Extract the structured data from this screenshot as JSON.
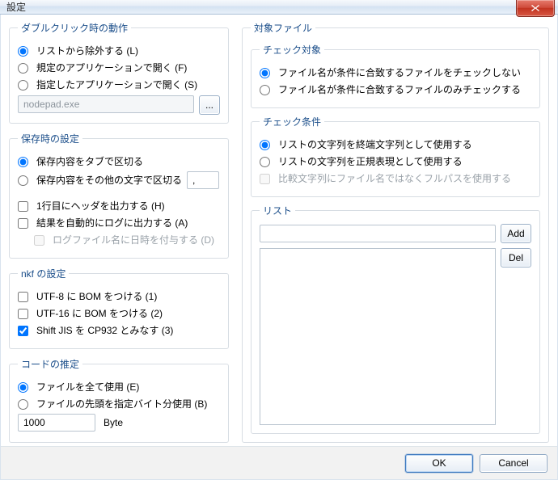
{
  "title": "設定",
  "close_icon": "close-icon",
  "dblclick": {
    "legend": "ダブルクリック時の動作",
    "opt_remove": "リストから除外する (L)",
    "opt_default_app": "規定のアプリケーションで開く (F)",
    "opt_specified_app": "指定したアプリケーションで開く (S)",
    "app_path": "nodepad.exe",
    "browse": "..."
  },
  "save": {
    "legend": "保存時の設定",
    "opt_tab": "保存内容をタブで区切る",
    "opt_other": "保存内容をその他の文字で区切る",
    "other_char": ",",
    "chk_header": "1行目にヘッダを出力する (H)",
    "chk_autolog": "結果を自動的にログに出力する (A)",
    "chk_logdate": "ログファイル名に日時を付与する (D)"
  },
  "nkf": {
    "legend": "nkf の設定",
    "chk_utf8": "UTF-8 に BOM をつける (1)",
    "chk_utf16": "UTF-16 に BOM をつける (2)",
    "chk_cp932": "Shift JIS を CP932 とみなす (3)"
  },
  "code": {
    "legend": "コードの推定",
    "opt_all": "ファイルを全て使用 (E)",
    "opt_head": "ファイルの先頭を指定バイト分使用 (B)",
    "bytes": "1000",
    "unit": "Byte"
  },
  "target": {
    "legend": "対象ファイル",
    "check_target": {
      "legend": "チェック対象",
      "opt_skip": "ファイル名が条件に合致するファイルをチェックしない",
      "opt_only": "ファイル名が条件に合致するファイルのみチェックする"
    },
    "check_cond": {
      "legend": "チェック条件",
      "opt_terminal": "リストの文字列を終端文字列として使用する",
      "opt_regex": "リストの文字列を正規表現として使用する",
      "chk_fullpath": "比較文字列にファイル名ではなくフルパスを使用する"
    },
    "list": {
      "legend": "リスト",
      "add": "Add",
      "del": "Del",
      "input": ""
    }
  },
  "buttons": {
    "ok": "OK",
    "cancel": "Cancel"
  }
}
